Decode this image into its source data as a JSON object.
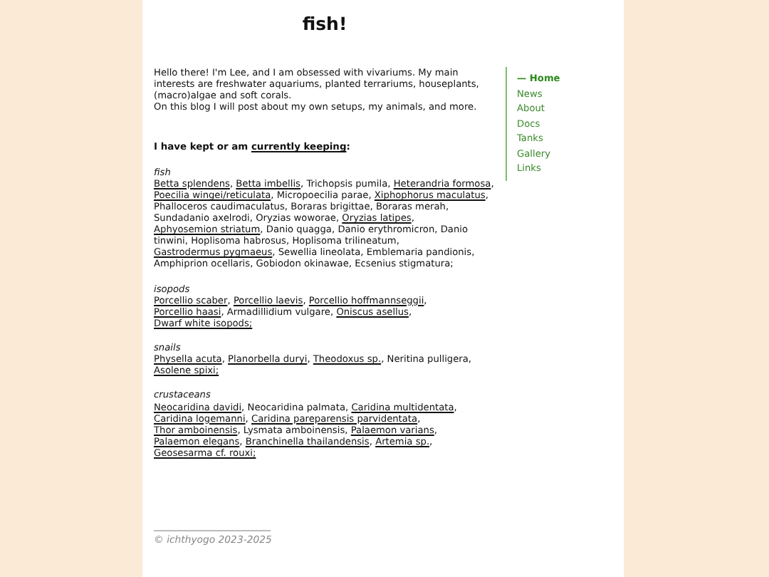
{
  "title": "fish!",
  "intro": [
    "Hello there! I'm Lee, and I am obsessed with vivariums. My main interests are freshwater aquariums, planted terrariums, houseplants, (macro)algae and soft corals.",
    "On this blog I will post about my own setups, my animals, and more."
  ],
  "heading": {
    "text": "I have kept or am ",
    "link": "currently keeping",
    "after": ":"
  },
  "groups": [
    {
      "name": "fish",
      "items": [
        {
          "text": "Betta splendens",
          "link": true,
          "sep": ","
        },
        {
          "text": "Betta imbellis",
          "link": true,
          "sep": ","
        },
        {
          "text": "Trichopsis pumila",
          "link": false,
          "sep": ","
        },
        {
          "text": "Heterandria formosa",
          "link": true,
          "sep": ","
        },
        {
          "text": "Poecilia wingei/reticulata",
          "link": true,
          "sep": ","
        },
        {
          "text": "Micropoecilia parae",
          "link": false,
          "sep": ","
        },
        {
          "text": "Xiphophorus maculatus",
          "link": true,
          "sep": ","
        },
        {
          "text": "Phalloceros caudimaculatus",
          "link": false,
          "sep": ","
        },
        {
          "text": "Boraras brigittae",
          "link": false,
          "sep": ","
        },
        {
          "text": "Boraras merah",
          "link": false,
          "sep": ","
        },
        {
          "text": "Sundadanio axelrodi",
          "link": false,
          "sep": ","
        },
        {
          "text": "Oryzias woworae",
          "link": false,
          "sep": ","
        },
        {
          "text": "Oryzias latipes",
          "link": true,
          "sep": ","
        },
        {
          "text": "Aphyosemion striatum",
          "link": true,
          "sep": ","
        },
        {
          "text": "Danio quagga",
          "link": false,
          "sep": ","
        },
        {
          "text": "Danio erythromicron",
          "link": false,
          "sep": ","
        },
        {
          "text": "Danio tinwini",
          "link": false,
          "sep": ","
        },
        {
          "text": "Hoplisoma habrosus",
          "link": false,
          "sep": ","
        },
        {
          "text": "Hoplisoma trilineatum",
          "link": false,
          "sep": ","
        },
        {
          "text": "Gastrodermus pygmaeus",
          "link": true,
          "sep": ","
        },
        {
          "text": "Sewellia lineolata",
          "link": false,
          "sep": ","
        },
        {
          "text": "Emblemaria pandionis",
          "link": false,
          "sep": ","
        },
        {
          "text": "Amphiprion ocellaris",
          "link": false,
          "sep": ","
        },
        {
          "text": "Gobiodon okinawae",
          "link": false,
          "sep": ","
        },
        {
          "text": "Ecsenius stigmatura;",
          "link": false
        }
      ]
    },
    {
      "name": "isopods",
      "items": [
        {
          "text": "Porcellio scaber",
          "link": true,
          "sep": ","
        },
        {
          "text": "Porcellio laevis",
          "link": true,
          "sep": ","
        },
        {
          "text": "Porcellio hoffmannseggii",
          "link": true,
          "sep": ","
        },
        {
          "text": "Porcellio haasi",
          "link": true,
          "sep": ","
        },
        {
          "text": "Armadillidium vulgare",
          "link": false,
          "sep": ","
        },
        {
          "text": "Oniscus asellus",
          "link": true,
          "sep": ","
        },
        {
          "text": "Dwarf white isopods;",
          "link": true
        }
      ]
    },
    {
      "name": "snails",
      "items": [
        {
          "text": "Physella acuta",
          "link": true,
          "sep": ","
        },
        {
          "text": "Planorbella duryi",
          "link": true,
          "sep": ","
        },
        {
          "text": "Theodoxus sp.",
          "link": true,
          "sep": ","
        },
        {
          "text": "Neritina pulligera",
          "link": false,
          "sep": ","
        },
        {
          "text": "Asolene spixi;",
          "link": true
        }
      ]
    },
    {
      "name": "crustaceans",
      "items": [
        {
          "text": "Neocaridina davidi",
          "link": true,
          "sep": ","
        },
        {
          "text": "Neocaridina palmata",
          "link": false,
          "sep": ","
        },
        {
          "text": "Caridina multidentata",
          "link": true,
          "sep": ","
        },
        {
          "text": "Caridina logemanni",
          "link": true,
          "sep": ","
        },
        {
          "text": "Caridina pareparensis parvidentata",
          "link": true,
          "sep": ","
        },
        {
          "text": "Thor amboinensis",
          "link": true,
          "sep": ","
        },
        {
          "text": "Lysmata amboinensis",
          "link": false,
          "sep": ","
        },
        {
          "text": "Palaemon varians",
          "link": true,
          "sep": ","
        },
        {
          "text": "Palaemon elegans",
          "link": true,
          "sep": ","
        },
        {
          "text": "Branchinella thailandensis",
          "link": true,
          "sep": ","
        },
        {
          "text": "Artemia sp.",
          "link": true,
          "sep": ","
        },
        {
          "text": "Geosesarma cf. rouxi;",
          "link": true
        }
      ]
    }
  ],
  "footer": "© ichthyogo 2023-2025",
  "nav": {
    "current_marker": "—",
    "items": [
      {
        "label": "Home",
        "selected": true
      },
      {
        "label": "News",
        "selected": false
      },
      {
        "label": "About",
        "selected": false
      },
      {
        "label": "Docs",
        "selected": false
      },
      {
        "label": "Tanks",
        "selected": false
      },
      {
        "label": "Gallery",
        "selected": false
      },
      {
        "label": "Links",
        "selected": false
      }
    ]
  }
}
